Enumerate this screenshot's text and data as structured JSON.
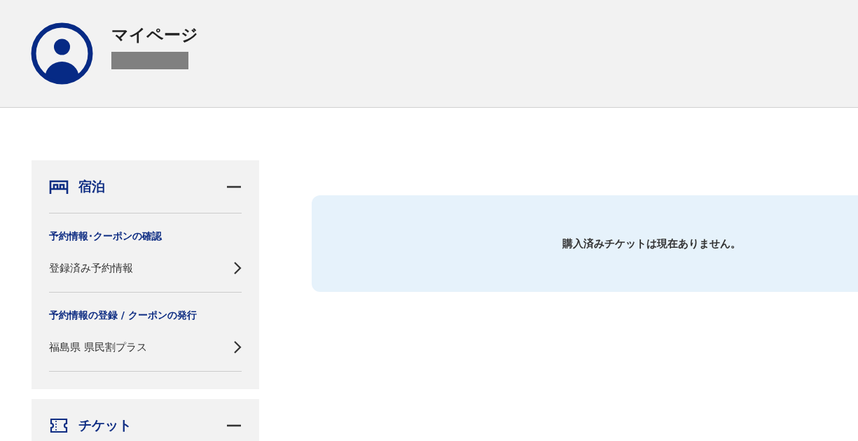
{
  "header": {
    "title": "マイページ",
    "name_redacted": true
  },
  "sidebar": {
    "sections": [
      {
        "kind": "bed",
        "title": "宿泊",
        "expanded": true,
        "groups": [
          {
            "heading": "予約情報･クーポンの確認",
            "links": [
              "登録済み予約情報"
            ]
          },
          {
            "heading": "予約情報の登録 / クーポンの発行",
            "links": [
              "福島県 県民割プラス"
            ]
          }
        ]
      },
      {
        "kind": "ticket",
        "title": "チケット",
        "expanded": true
      }
    ]
  },
  "notice": {
    "message": "購入済みチケットは現在ありません。"
  }
}
